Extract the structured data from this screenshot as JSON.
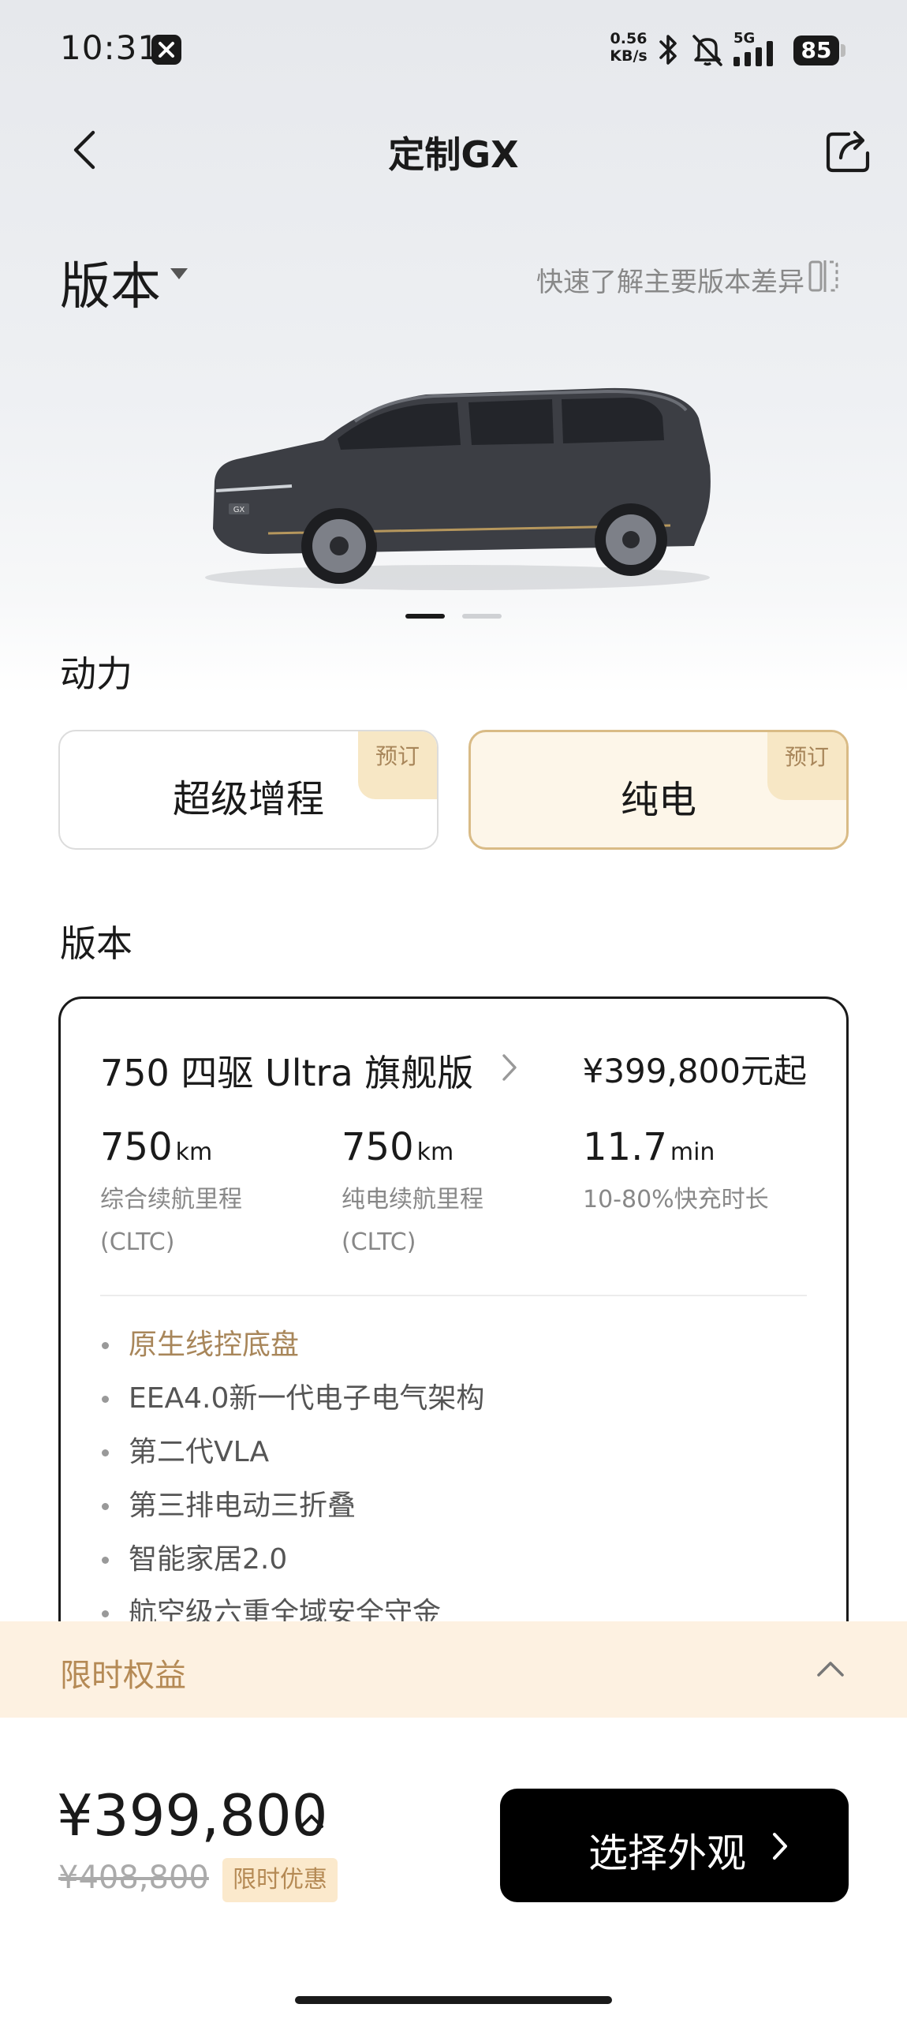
{
  "status_bar": {
    "time": "10:31",
    "net_speed_value": "0.56",
    "net_speed_unit": "KB/s",
    "signal_type": "5G",
    "battery": "85",
    "icons": [
      "app-x-icon",
      "bluetooth-icon",
      "mute-icon",
      "signal-icon"
    ]
  },
  "nav": {
    "title": "定制GX",
    "back_icon": "chevron-left-icon",
    "share_icon": "share-icon"
  },
  "header": {
    "section_title": "版本",
    "compare_link": "快速了解主要版本差异"
  },
  "gallery": {
    "car_model_badge": "GX",
    "active_slide": 1,
    "slide_count": 2
  },
  "power": {
    "label": "动力",
    "options": [
      {
        "label": "超级增程",
        "tag": "预订",
        "selected": false
      },
      {
        "label": "纯电",
        "tag": "预订",
        "selected": true
      }
    ]
  },
  "versions": {
    "label": "版本",
    "selected": {
      "name": "750 四驱 Ultra 旗舰版",
      "price": "¥399,800元起",
      "specs": [
        {
          "value": "750",
          "unit": "km",
          "label1": "综合续航里程",
          "label2": "(CLTC)"
        },
        {
          "value": "750",
          "unit": "km",
          "label1": "纯电续航里程",
          "label2": "(CLTC)"
        },
        {
          "value": "11.7",
          "unit": "min",
          "label1": "10-80%快充时长",
          "label2": ""
        }
      ],
      "features": [
        "原生线控底盘",
        "EEA4.0新一代电子电气架构",
        "第二代VLA",
        "第三排电动三折叠",
        "智能家居2.0",
        "航空级六重全域安全守金"
      ]
    }
  },
  "benefits": {
    "label": "限时权益"
  },
  "bottom": {
    "price": "¥399,800",
    "original_price": "¥408,800",
    "deal_badge": "限时优惠",
    "cta": "选择外观"
  },
  "colors": {
    "accent_gold": "#b58a55",
    "selected_bg": "#fdf6e9",
    "tag_bg": "#f7e7c5",
    "cta_bg": "#000000"
  }
}
